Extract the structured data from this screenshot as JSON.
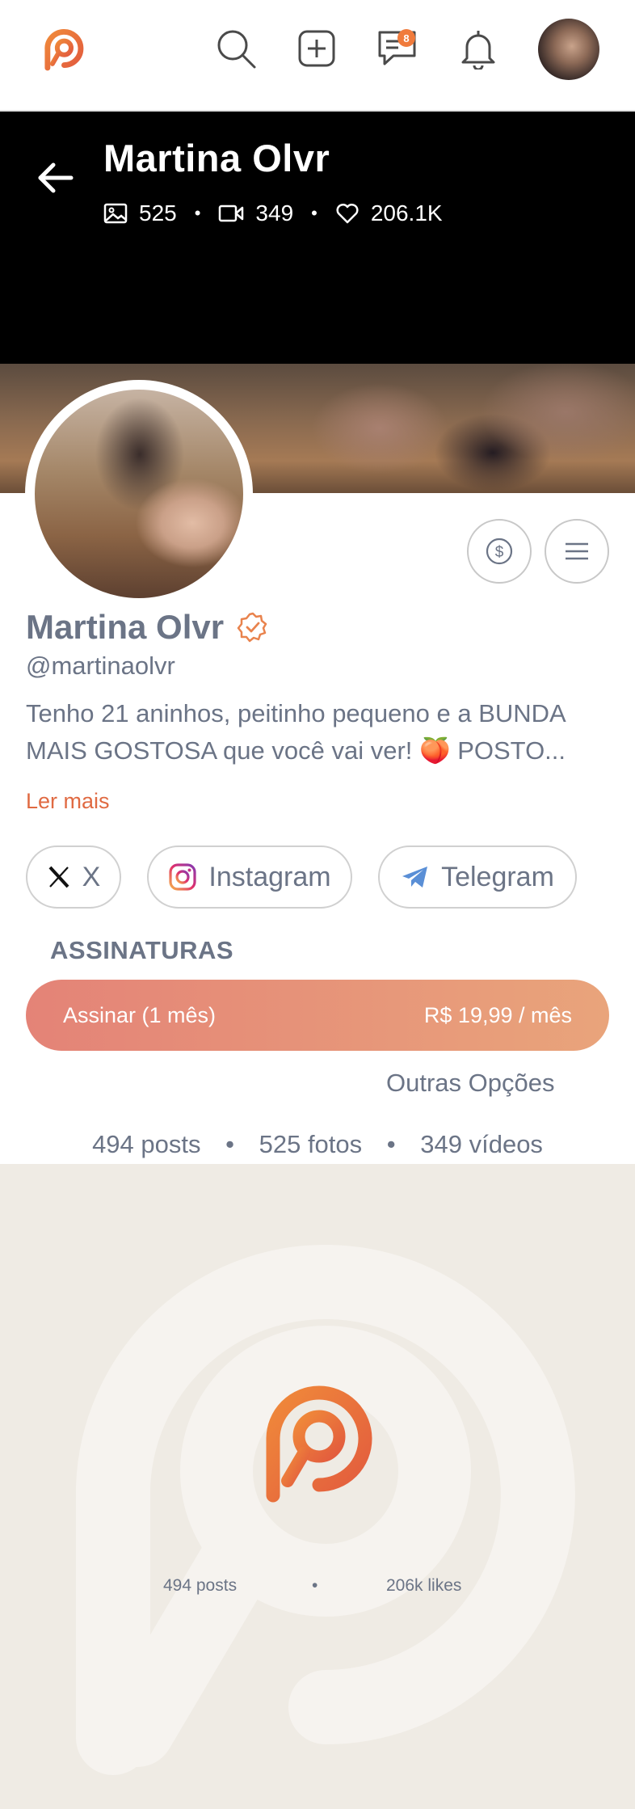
{
  "nav": {
    "messages_badge": "8",
    "icons": [
      "logo-icon",
      "search-icon",
      "plus-square-icon",
      "chat-icon",
      "bell-icon",
      "avatar"
    ]
  },
  "profile": {
    "header_name": "Martina Olvr",
    "photos_count": "525",
    "videos_count": "349",
    "likes_count": "206.1K",
    "name": "Martina Olvr",
    "handle": "@martinaolvr",
    "bio": "Tenho 21 aninhos, peitinho pequeno e a BUNDA MAIS GOSTOSA que você vai ver! 🍑 POSTO...",
    "read_more": "Ler mais"
  },
  "socials": {
    "x_label": "X",
    "instagram_label": "Instagram",
    "telegram_label": "Telegram"
  },
  "subscriptions": {
    "title": "ASSINATURAS",
    "button_label": "Assinar (1 mês)",
    "price": "R$ 19,99 / mês",
    "other_options": "Outras Opções"
  },
  "counts": {
    "posts": "494 posts",
    "photos": "525 fotos",
    "videos": "349 vídeos",
    "separator": "•"
  },
  "placeholder": {
    "posts": "494 posts",
    "separator": "•",
    "likes": "206k likes"
  },
  "colors": {
    "brand_orange": "#e06a42",
    "text_gray": "#6b7486",
    "subscribe_gradient_start": "#e48377",
    "subscribe_gradient_end": "#e9a47b",
    "placeholder_bg": "#efebe4"
  }
}
